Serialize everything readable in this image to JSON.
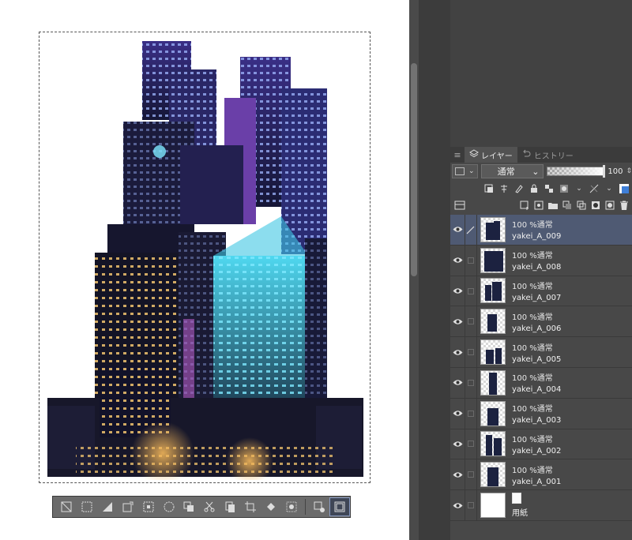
{
  "panel": {
    "tabs": [
      {
        "label": "レイヤー",
        "icon": "layers-icon",
        "active": true
      },
      {
        "label": "ヒストリー",
        "icon": "history-icon",
        "active": false
      }
    ],
    "blend_mode": "通常",
    "opacity_value": "100"
  },
  "layers": [
    {
      "mode": "100 %通常",
      "name": "yakei_A_009",
      "selected": true
    },
    {
      "mode": "100 %通常",
      "name": "yakei_A_008",
      "selected": false
    },
    {
      "mode": "100 %通常",
      "name": "yakei_A_007",
      "selected": false
    },
    {
      "mode": "100 %通常",
      "name": "yakei_A_006",
      "selected": false
    },
    {
      "mode": "100 %通常",
      "name": "yakei_A_005",
      "selected": false
    },
    {
      "mode": "100 %通常",
      "name": "yakei_A_004",
      "selected": false
    },
    {
      "mode": "100 %通常",
      "name": "yakei_A_003",
      "selected": false
    },
    {
      "mode": "100 %通常",
      "name": "yakei_A_002",
      "selected": false
    },
    {
      "mode": "100 %通常",
      "name": "yakei_A_001",
      "selected": false
    },
    {
      "mode": "",
      "name": "用紙",
      "selected": false,
      "paper": true
    }
  ],
  "selection_toolbar": {
    "icons": [
      "deselect-icon",
      "invert-selection-icon",
      "fill-selection-icon",
      "scale-icon",
      "expand-selection-icon",
      "shrink-selection-icon",
      "copy-paste-icon",
      "cut-icon",
      "copy-icon",
      "crop-icon",
      "fill-icon",
      "quick-mask-icon",
      "settings-icon",
      "fit-icon"
    ]
  },
  "colors": {
    "accent": "#4f5a73",
    "panel_bg": "#484848",
    "night_blue": "#2a2a6a",
    "neon_cyan": "#4fd8f0",
    "warm_light": "#f5b85a"
  }
}
